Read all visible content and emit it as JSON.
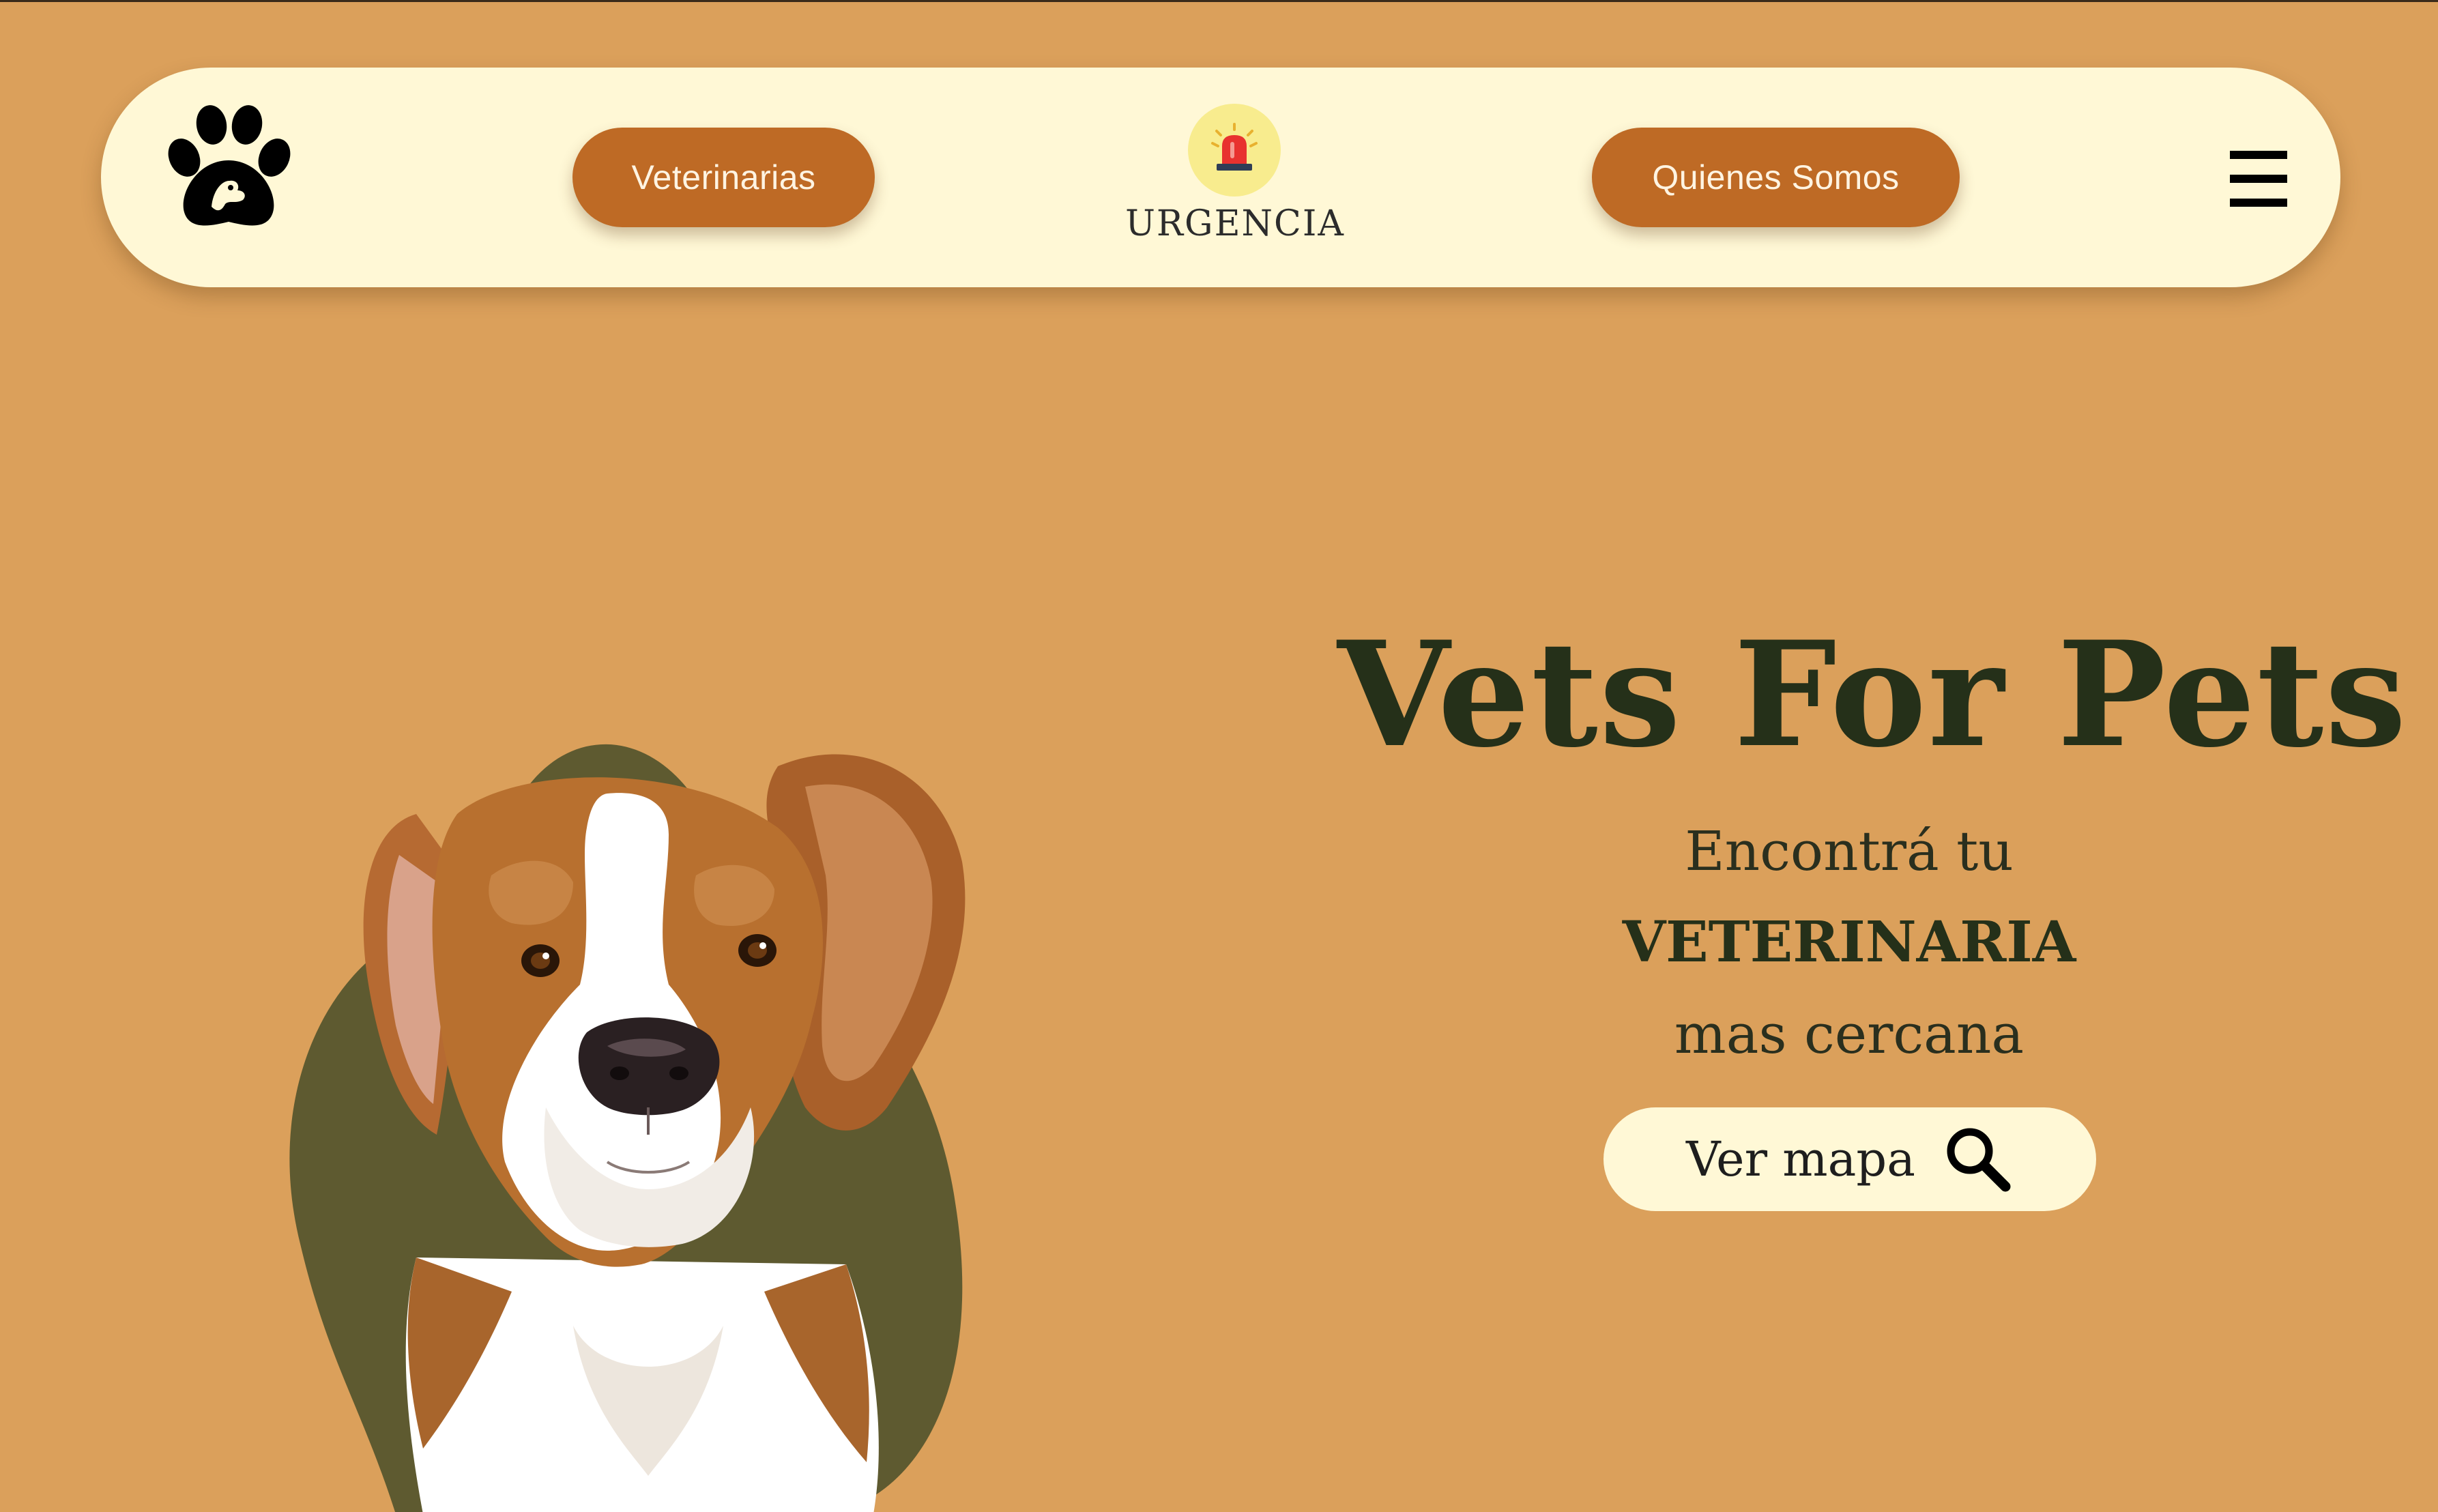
{
  "nav": {
    "logo_icon": "paw-dog-logo-icon",
    "veterinarias_label": "Veterinarias",
    "urgency_icon": "siren-icon",
    "urgency_label": "URGENCIA",
    "quienes_label": "Quienes Somos",
    "menu_icon": "hamburger-menu-icon"
  },
  "hero": {
    "title": "Vets For Pets",
    "line1": "Encontrá tu",
    "line2": "VETERINARIA",
    "line3": "mas cercana",
    "map_button_label": "Ver mapa",
    "map_button_icon": "search-icon",
    "image": "beagle-dog-photo"
  },
  "colors": {
    "background": "#DBA05B",
    "navbar": "#FFF8D6",
    "button": "#BE6A25",
    "title": "#253019",
    "blob": "#5E5A30"
  }
}
